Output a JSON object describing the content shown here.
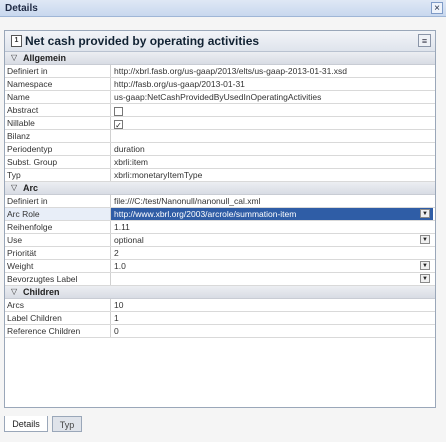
{
  "window": {
    "title": "Details",
    "close_glyph": "×"
  },
  "panel": {
    "title": "Net cash provided by operating activities",
    "icon_text": "1",
    "menu_glyph": "≡"
  },
  "sections": {
    "allgemein": {
      "title": "Allgemein",
      "rows": [
        {
          "label": "Definiert in",
          "value": "http://xbrl.fasb.org/us-gaap/2013/elts/us-gaap-2013-01-31.xsd"
        },
        {
          "label": "Namespace",
          "value": "http://fasb.org/us-gaap/2013-01-31"
        },
        {
          "label": "Name",
          "value": "us-gaap:NetCashProvidedByUsedInOperatingActivities"
        },
        {
          "label": "Abstract",
          "value": ""
        },
        {
          "label": "Nillable",
          "value": "✓"
        },
        {
          "label": "Bilanz",
          "value": ""
        },
        {
          "label": "Periodentyp",
          "value": "duration"
        },
        {
          "label": "Subst. Group",
          "value": "xbrli:item"
        },
        {
          "label": "Typ",
          "value": "xbrli:monetaryItemType"
        }
      ]
    },
    "arc": {
      "title": "Arc",
      "rows": [
        {
          "label": "Definiert in",
          "value": "file:///C:/test/Nanonull/nanonull_cal.xml"
        },
        {
          "label": "Arc Role",
          "value": "http://www.xbrl.org/2003/arcrole/summation-item"
        },
        {
          "label": "Reihenfolge",
          "value": "1.11"
        },
        {
          "label": "Use",
          "value": "optional"
        },
        {
          "label": "Priorität",
          "value": "2"
        },
        {
          "label": "Weight",
          "value": "1.0"
        },
        {
          "label": "Bevorzugtes Label",
          "value": ""
        }
      ]
    },
    "children": {
      "title": "Children",
      "rows": [
        {
          "label": "Arcs",
          "value": "10"
        },
        {
          "label": "Label Children",
          "value": "1"
        },
        {
          "label": "Reference Children",
          "value": "0"
        }
      ]
    }
  },
  "tabs": {
    "details": "Details",
    "typ": "Typ"
  },
  "colors": {
    "selection": "#2f5da6",
    "header_bg": "#dfe4ec"
  },
  "icons": {
    "section_toggle": "▽",
    "dropdown": "▼"
  }
}
